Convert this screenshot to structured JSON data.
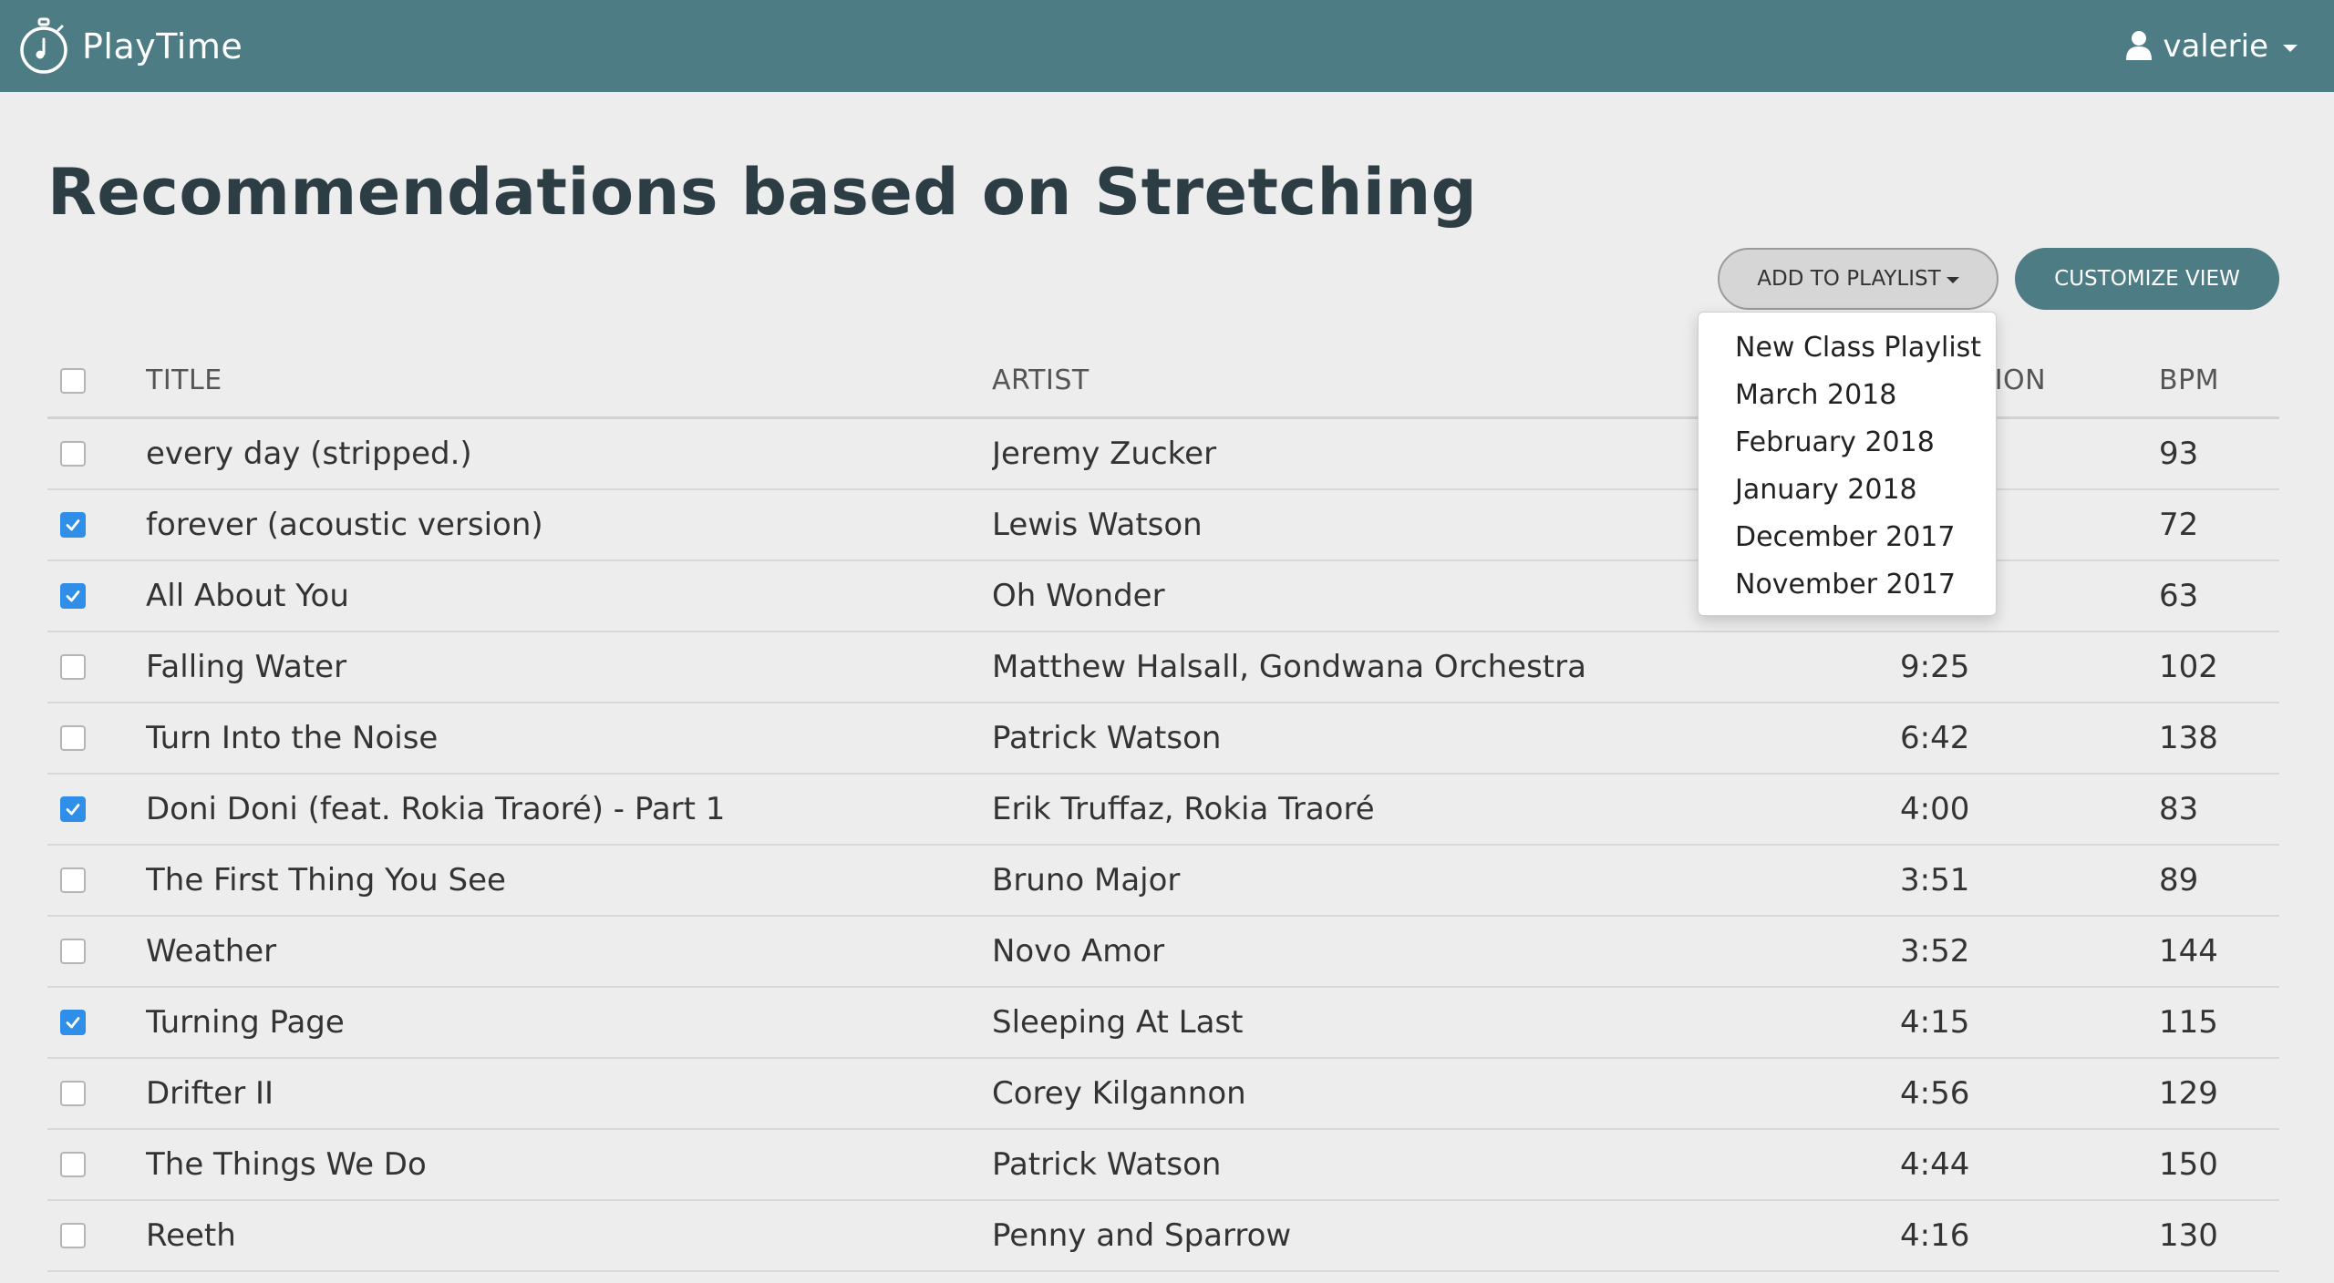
{
  "app": {
    "name": "PlayTime"
  },
  "user": {
    "name": "valerie"
  },
  "page": {
    "title": "Recommendations based on Stretching"
  },
  "toolbar": {
    "add_to_playlist_label": "ADD TO PLAYLIST",
    "customize_view_label": "CUSTOMIZE VIEW"
  },
  "playlist_dropdown": {
    "items": [
      "New Class Playlist",
      "March 2018",
      "February 2018",
      "January 2018",
      "December 2017",
      "November 2017"
    ]
  },
  "table": {
    "headers": {
      "title": "TITLE",
      "artist": "ARTIST",
      "duration": "DURATION",
      "bpm": "BPM"
    },
    "rows": [
      {
        "checked": false,
        "title": "every day (stripped.)",
        "artist": "Jeremy Zucker",
        "duration": "",
        "bpm": "93"
      },
      {
        "checked": true,
        "title": "forever (acoustic version)",
        "artist": "Lewis Watson",
        "duration": "",
        "bpm": "72"
      },
      {
        "checked": true,
        "title": "All About You",
        "artist": "Oh Wonder",
        "duration": "",
        "bpm": "63"
      },
      {
        "checked": false,
        "title": "Falling Water",
        "artist": "Matthew Halsall, Gondwana Orchestra",
        "duration": "9:25",
        "bpm": "102"
      },
      {
        "checked": false,
        "title": "Turn Into the Noise",
        "artist": "Patrick Watson",
        "duration": "6:42",
        "bpm": "138"
      },
      {
        "checked": true,
        "title": "Doni Doni (feat. Rokia Traoré) - Part 1",
        "artist": "Erik Truffaz, Rokia Traoré",
        "duration": "4:00",
        "bpm": "83"
      },
      {
        "checked": false,
        "title": "The First Thing You See",
        "artist": "Bruno Major",
        "duration": "3:51",
        "bpm": "89"
      },
      {
        "checked": false,
        "title": "Weather",
        "artist": "Novo Amor",
        "duration": "3:52",
        "bpm": "144"
      },
      {
        "checked": true,
        "title": "Turning Page",
        "artist": "Sleeping At Last",
        "duration": "4:15",
        "bpm": "115"
      },
      {
        "checked": false,
        "title": "Drifter II",
        "artist": "Corey Kilgannon",
        "duration": "4:56",
        "bpm": "129"
      },
      {
        "checked": false,
        "title": "The Things We Do",
        "artist": "Patrick Watson",
        "duration": "4:44",
        "bpm": "150"
      },
      {
        "checked": false,
        "title": "Reeth",
        "artist": "Penny and Sparrow",
        "duration": "4:16",
        "bpm": "130"
      }
    ]
  },
  "colors": {
    "navbar": "#4d7c84",
    "checkbox_checked": "#2f8fe8",
    "background": "#ededed"
  }
}
